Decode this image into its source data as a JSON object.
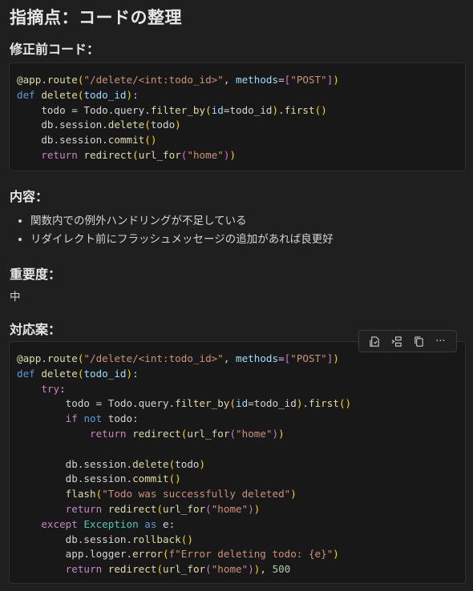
{
  "title": "指摘点：コードの整理",
  "sections": {
    "before": "修正前コード：",
    "content": "内容：",
    "importance": "重要度：",
    "remedy": "対応案："
  },
  "content_items": [
    "関数内での例外ハンドリングが不足している",
    "リダイレクト前にフラッシュメッセージの追加があれば良更好"
  ],
  "importance_value": "中",
  "toolbar": {
    "icons": [
      "apply-icon",
      "insert-icon",
      "copy-icon",
      "more-icon"
    ],
    "more_label": "···"
  },
  "code_before": [
    "@app.route(\"/delete/<int:todo_id>\", methods=[\"POST\"])",
    "def delete(todo_id):",
    "    todo = Todo.query.filter_by(id=todo_id).first()",
    "    db.session.delete(todo)",
    "    db.session.commit()",
    "    return redirect(url_for(\"home\"))"
  ],
  "code_after": [
    "@app.route(\"/delete/<int:todo_id>\", methods=[\"POST\"])",
    "def delete(todo_id):",
    "    try:",
    "        todo = Todo.query.filter_by(id=todo_id).first()",
    "        if not todo:",
    "            return redirect(url_for(\"home\"))",
    "",
    "        db.session.delete(todo)",
    "        db.session.commit()",
    "        flash(\"Todo was successfully deleted\")",
    "        return redirect(url_for(\"home\"))",
    "    except Exception as e:",
    "        db.session.rollback()",
    "        app.logger.error(f\"Error deleting todo: {e}\")",
    "        return redirect(url_for(\"home\")), 500"
  ]
}
